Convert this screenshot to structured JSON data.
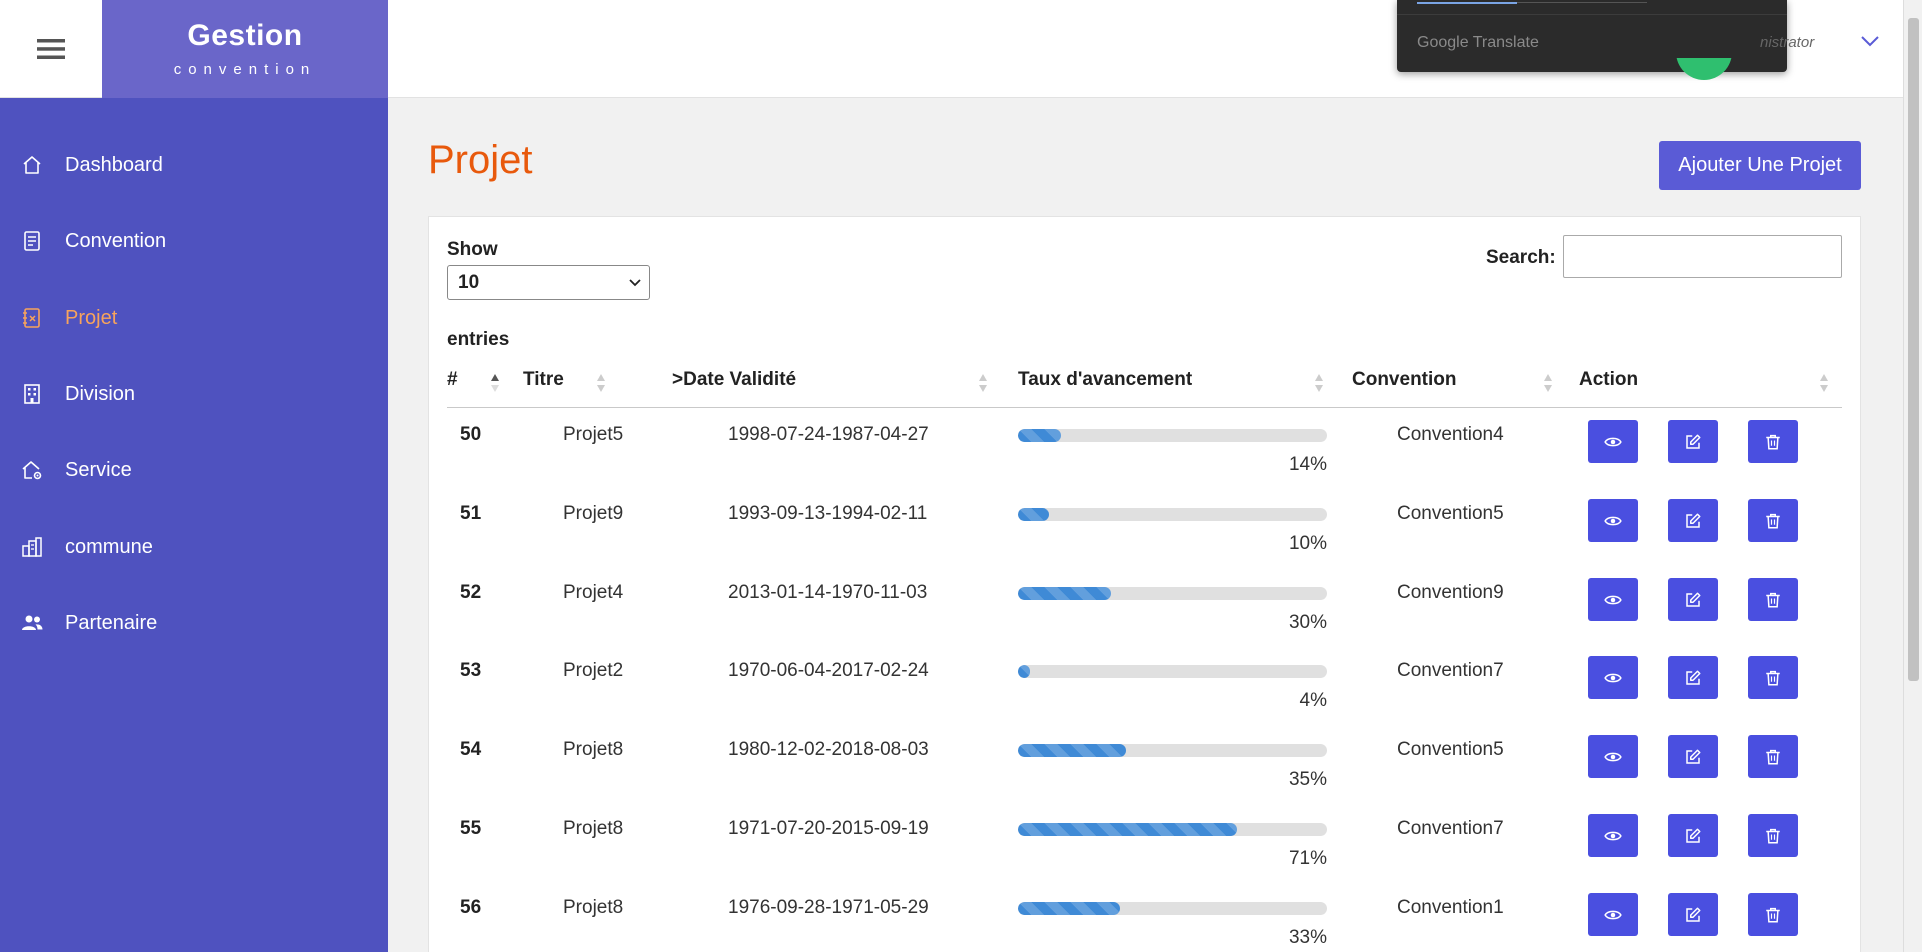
{
  "header": {
    "brand_title": "Gestion",
    "brand_subtitle": "convention",
    "google_translate_label": "Google Translate",
    "user_name_partial": "nistrator"
  },
  "sidebar": {
    "items": [
      {
        "label": "Dashboard",
        "icon": "home-icon",
        "active": false
      },
      {
        "label": "Convention",
        "icon": "document-icon",
        "active": false
      },
      {
        "label": "Projet",
        "icon": "project-icon",
        "active": true
      },
      {
        "label": "Division",
        "icon": "building-icon",
        "active": false
      },
      {
        "label": "Service",
        "icon": "house-gear-icon",
        "active": false
      },
      {
        "label": "commune",
        "icon": "city-icon",
        "active": false
      },
      {
        "label": "Partenaire",
        "icon": "users-icon",
        "active": false
      }
    ]
  },
  "main": {
    "title": "Projet",
    "add_button": "Ajouter Une Projet"
  },
  "table_controls": {
    "show_label": "Show",
    "show_value": "10",
    "entries_label": "entries",
    "search_label": "Search:",
    "search_value": ""
  },
  "table": {
    "columns": [
      "#",
      "Titre",
      ">Date Validité",
      "Taux d'avancement",
      "Convention",
      "Action"
    ],
    "rows": [
      {
        "id": "50",
        "titre": "Projet5",
        "date": "1998-07-24-1987-04-27",
        "progress": 14,
        "progress_label": "14%",
        "convention": "Convention4"
      },
      {
        "id": "51",
        "titre": "Projet9",
        "date": "1993-09-13-1994-02-11",
        "progress": 10,
        "progress_label": "10%",
        "convention": "Convention5"
      },
      {
        "id": "52",
        "titre": "Projet4",
        "date": "2013-01-14-1970-11-03",
        "progress": 30,
        "progress_label": "30%",
        "convention": "Convention9"
      },
      {
        "id": "53",
        "titre": "Projet2",
        "date": "1970-06-04-2017-02-24",
        "progress": 4,
        "progress_label": "4%",
        "convention": "Convention7"
      },
      {
        "id": "54",
        "titre": "Projet8",
        "date": "1980-12-02-2018-08-03",
        "progress": 35,
        "progress_label": "35%",
        "convention": "Convention5"
      },
      {
        "id": "55",
        "titre": "Projet8",
        "date": "1971-07-20-2015-09-19",
        "progress": 71,
        "progress_label": "71%",
        "convention": "Convention7"
      },
      {
        "id": "56",
        "titre": "Projet8",
        "date": "1976-09-28-1971-05-29",
        "progress": 33,
        "progress_label": "33%",
        "convention": "Convention1"
      }
    ]
  },
  "colors": {
    "sidebar_bg": "#4f52bf",
    "brand_bg": "#6a66c9",
    "active_nav": "#f7a35c",
    "title_color": "#e8590c",
    "action_button": "#4a4fe0",
    "progress_fill": "#3f8ad6"
  }
}
